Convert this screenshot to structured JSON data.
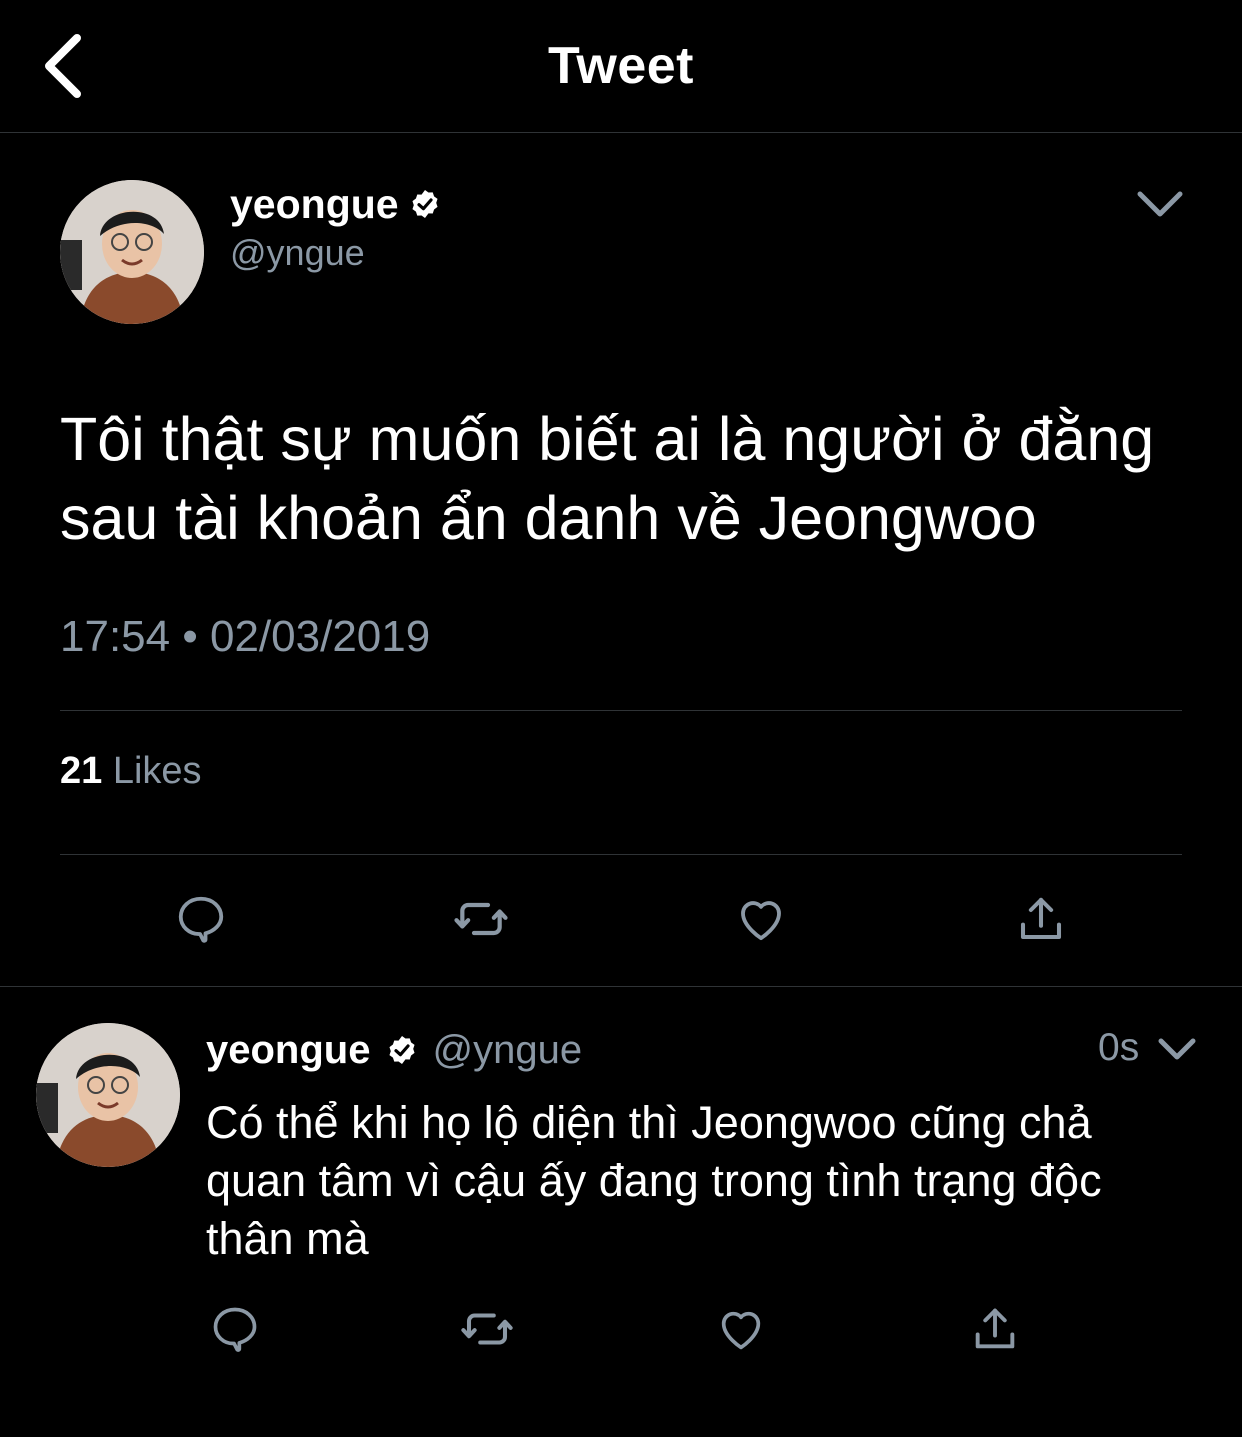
{
  "header": {
    "title": "Tweet",
    "back_icon": "chevron-left-icon"
  },
  "tweet": {
    "author_name": "yeongue",
    "author_handle": "@yngue",
    "text_line1": "Tôi thật sự muốn biết ai là người ở đằng",
    "text_line2": "sau tài khoản ẩn danh về Jeongwoo",
    "time": "17:54",
    "separator": "•",
    "date": "02/03/2019",
    "likes_count": "21",
    "likes_label": "Likes"
  },
  "reply": {
    "author_name": "yeongue",
    "author_handle": "@yngue",
    "age": "0s",
    "text_line1": "Có thể khi họ lộ diện thì Jeongwoo cũng chả",
    "text_line2": "quan tâm vì cậu ấy đang trong tình trạng độc",
    "text_line3": "thân mà"
  },
  "icons": [
    "reply-icon",
    "retweet-icon",
    "like-icon",
    "share-icon",
    "verified-badge-icon",
    "chevron-down-icon"
  ],
  "colors": {
    "background": "#000000",
    "text": "#ffffff",
    "muted": "#8b98a5",
    "divider": "#2f3336"
  }
}
